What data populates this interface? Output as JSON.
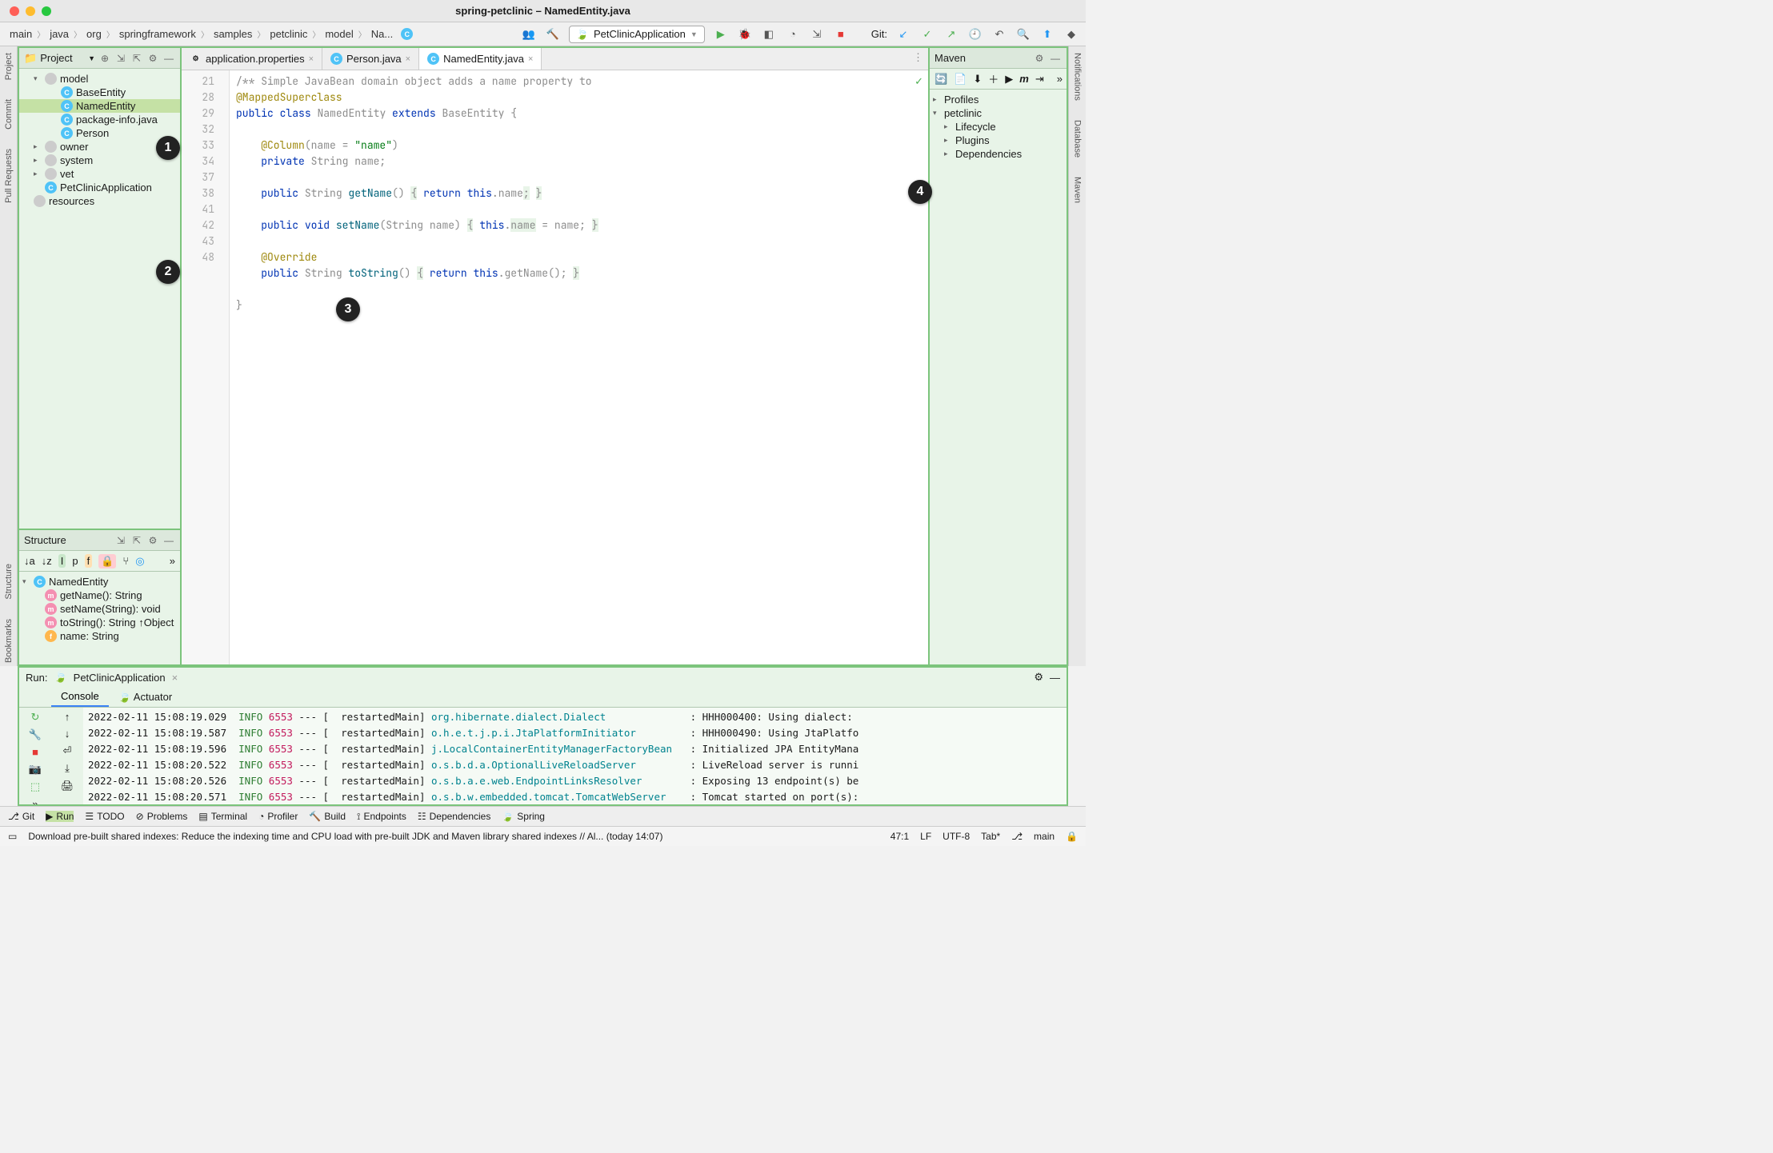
{
  "window": {
    "title": "spring-petclinic – NamedEntity.java"
  },
  "breadcrumbs": [
    "main",
    "java",
    "org",
    "springframework",
    "samples",
    "petclinic",
    "model",
    "Na..."
  ],
  "run_config": "PetClinicApplication",
  "git_label": "Git:",
  "left_tabs": [
    "Project",
    "Commit",
    "Pull Requests",
    "Structure",
    "Bookmarks"
  ],
  "right_tabs": [
    "Notifications",
    "Database",
    "Maven"
  ],
  "project": {
    "title": "Project",
    "nodes": [
      {
        "d": 1,
        "arr": "▾",
        "icon": "fld",
        "label": "model"
      },
      {
        "d": 2,
        "icon": "cls",
        "label": "BaseEntity"
      },
      {
        "d": 2,
        "icon": "cls",
        "label": "NamedEntity",
        "sel": true
      },
      {
        "d": 2,
        "icon": "cls",
        "label": "package-info.java"
      },
      {
        "d": 2,
        "icon": "cls",
        "label": "Person"
      },
      {
        "d": 1,
        "arr": "▸",
        "icon": "fld",
        "label": "owner"
      },
      {
        "d": 1,
        "arr": "▸",
        "icon": "fld",
        "label": "system"
      },
      {
        "d": 1,
        "arr": "▸",
        "icon": "fld",
        "label": "vet"
      },
      {
        "d": 1,
        "icon": "cls",
        "label": "PetClinicApplication"
      },
      {
        "d": 0,
        "icon": "fld",
        "label": "resources"
      }
    ]
  },
  "structure": {
    "title": "Structure",
    "nodes": [
      {
        "d": 0,
        "arr": "▾",
        "icon": "cls",
        "label": "NamedEntity"
      },
      {
        "d": 1,
        "icon": "m",
        "label": "getName(): String"
      },
      {
        "d": 1,
        "icon": "m",
        "label": "setName(String): void"
      },
      {
        "d": 1,
        "icon": "m",
        "label": "toString(): String ↑Object"
      },
      {
        "d": 1,
        "icon": "f",
        "label": "name: String"
      }
    ]
  },
  "editor": {
    "tabs": [
      {
        "label": "application.properties",
        "icon": "prop"
      },
      {
        "label": "Person.java",
        "icon": "cls"
      },
      {
        "label": "NamedEntity.java",
        "icon": "cls",
        "active": true
      }
    ],
    "gutter": [
      "21",
      "28",
      "29",
      "",
      "",
      "32",
      "33",
      "34",
      "37",
      "38",
      "41",
      "42",
      "43",
      "",
      "",
      "48"
    ],
    "code_lines": [
      {
        "t": "/** Simple JavaBean domain object adds a name property to <cod",
        "cls": "cmt"
      },
      {
        "t": "@MappedSuperclass",
        "cls": "ann"
      },
      {
        "html": "<span class=kw>public</span> <span class=kw>class</span> NamedEntity <span class=kw>extends</span> BaseEntity {"
      },
      {
        "t": ""
      },
      {
        "html": "    <span class=ann>@Column</span>(name = <span class=str>\"name\"</span>)"
      },
      {
        "html": "    <span class=kw>private</span> String name;"
      },
      {
        "t": ""
      },
      {
        "html": "    <span class=kw>public</span> String <span class=mth>getName</span>() <span class=hl>{</span> <span class=kw>return</span> <span class=kw>this</span>.name<span class=hl>;</span> <span class=hl>}</span>"
      },
      {
        "t": ""
      },
      {
        "html": "    <span class=kw>public</span> <span class=kw>void</span> <span class=mth>setName</span>(String name) <span class=hl>{</span> <span class=kw>this</span>.<span class=hl>name</span> = name; <span class=hl>}</span>"
      },
      {
        "t": ""
      },
      {
        "html": "    <span class=ann>@Override</span>"
      },
      {
        "html": "    <span class=kw>public</span> String <span class=mth>toString</span>() <span class=hl>{</span> <span class=kw>return</span> <span class=kw>this</span>.getName(); <span class=hl>}</span>"
      },
      {
        "t": ""
      },
      {
        "t": "}"
      },
      {
        "t": ""
      }
    ]
  },
  "maven": {
    "title": "Maven",
    "nodes": [
      {
        "d": 0,
        "arr": "▸",
        "label": "Profiles"
      },
      {
        "d": 0,
        "arr": "▾",
        "label": "petclinic"
      },
      {
        "d": 1,
        "arr": "▸",
        "label": "Lifecycle"
      },
      {
        "d": 1,
        "arr": "▸",
        "label": "Plugins"
      },
      {
        "d": 1,
        "arr": "▸",
        "label": "Dependencies"
      }
    ]
  },
  "run": {
    "title": "Run:",
    "config": "PetClinicApplication",
    "tabs": [
      "Console",
      "Actuator"
    ],
    "lines": [
      {
        "ts": "2022-02-11 15:08:19.029",
        "lvl": "INFO",
        "pid": "6553",
        "thr": "restartedMain",
        "cls": "org.hibernate.dialect.Dialect",
        "msg": ": HHH000400: Using dialect:"
      },
      {
        "ts": "2022-02-11 15:08:19.587",
        "lvl": "INFO",
        "pid": "6553",
        "thr": "restartedMain",
        "cls": "o.h.e.t.j.p.i.JtaPlatformInitiator",
        "msg": ": HHH000490: Using JtaPlatfo"
      },
      {
        "ts": "2022-02-11 15:08:19.596",
        "lvl": "INFO",
        "pid": "6553",
        "thr": "restartedMain",
        "cls": "j.LocalContainerEntityManagerFactoryBean",
        "msg": ": Initialized JPA EntityMana"
      },
      {
        "ts": "2022-02-11 15:08:20.522",
        "lvl": "INFO",
        "pid": "6553",
        "thr": "restartedMain",
        "cls": "o.s.b.d.a.OptionalLiveReloadServer",
        "msg": ": LiveReload server is runni"
      },
      {
        "ts": "2022-02-11 15:08:20.526",
        "lvl": "INFO",
        "pid": "6553",
        "thr": "restartedMain",
        "cls": "o.s.b.a.e.web.EndpointLinksResolver",
        "msg": ": Exposing 13 endpoint(s) be"
      },
      {
        "ts": "2022-02-11 15:08:20.571",
        "lvl": "INFO",
        "pid": "6553",
        "thr": "restartedMain",
        "cls": "o.s.b.w.embedded.tomcat.TomcatWebServer",
        "msg": ": Tomcat started on port(s):"
      }
    ]
  },
  "bottom_bar": [
    "Git",
    "Run",
    "TODO",
    "Problems",
    "Terminal",
    "Profiler",
    "Build",
    "Endpoints",
    "Dependencies",
    "Spring"
  ],
  "status": {
    "msg": "Download pre-built shared indexes: Reduce the indexing time and CPU load with pre-built JDK and Maven library shared indexes // Al... (today 14:07)",
    "pos": "47:1",
    "enc": "LF",
    "charset": "UTF-8",
    "indent": "Tab*",
    "branch": "main"
  },
  "callouts": [
    "1",
    "2",
    "3",
    "4"
  ]
}
